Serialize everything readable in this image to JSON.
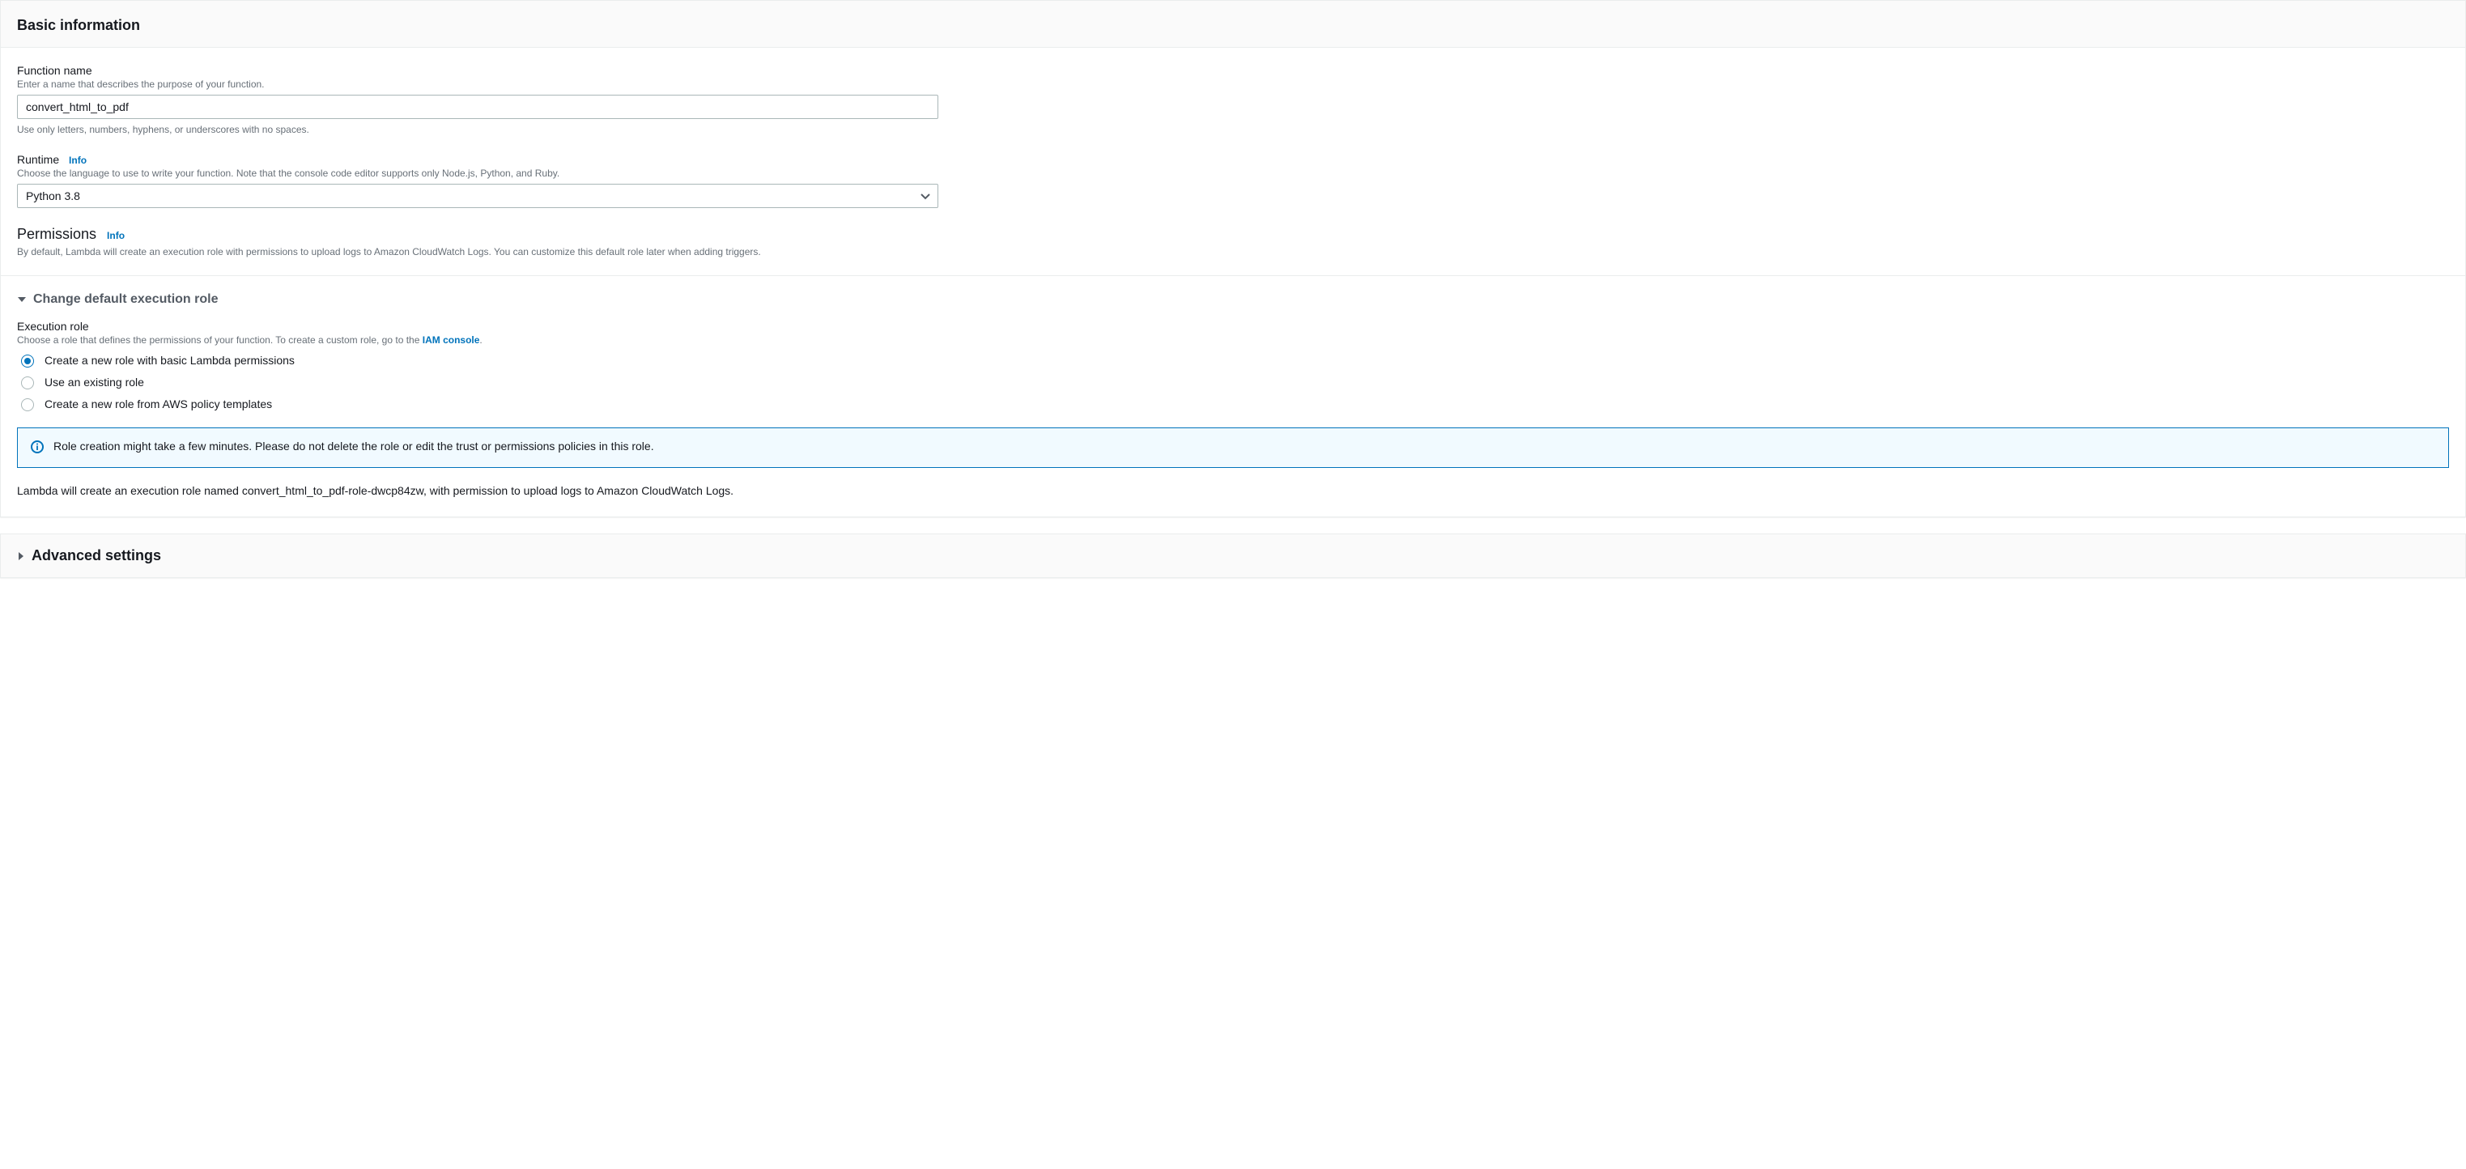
{
  "basic": {
    "heading": "Basic information",
    "functionName": {
      "label": "Function name",
      "description": "Enter a name that describes the purpose of your function.",
      "value": "convert_html_to_pdf",
      "hint": "Use only letters, numbers, hyphens, or underscores with no spaces."
    },
    "runtime": {
      "label": "Runtime",
      "infoLabel": "Info",
      "description": "Choose the language to use to write your function. Note that the console code editor supports only Node.js, Python, and Ruby.",
      "value": "Python 3.8"
    },
    "permissions": {
      "heading": "Permissions",
      "infoLabel": "Info",
      "description": "By default, Lambda will create an execution role with permissions to upload logs to Amazon CloudWatch Logs. You can customize this default role later when adding triggers."
    },
    "executionRole": {
      "expandHeading": "Change default execution role",
      "label": "Execution role",
      "descriptionPrefix": "Choose a role that defines the permissions of your function. To create a custom role, go to the ",
      "iamLinkText": "IAM console",
      "descriptionSuffix": ".",
      "options": {
        "newBasic": "Create a new role with basic Lambda permissions",
        "existing": "Use an existing role",
        "fromTemplate": "Create a new role from AWS policy templates"
      },
      "infoBox": "Role creation might take a few minutes. Please do not delete the role or edit the trust or permissions policies in this role.",
      "roleCreationText": "Lambda will create an execution role named convert_html_to_pdf-role-dwcp84zw, with permission to upload logs to Amazon CloudWatch Logs."
    }
  },
  "advanced": {
    "heading": "Advanced settings"
  }
}
